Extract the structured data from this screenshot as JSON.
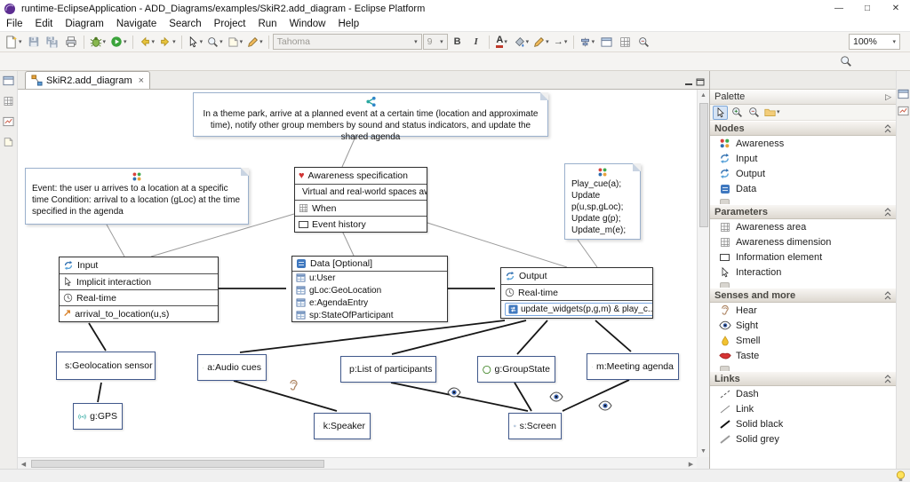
{
  "window": {
    "title": "runtime-EclipseApplication - ADD_Diagrams/examples/SkiR2.add_diagram - Eclipse Platform",
    "minimize": "—",
    "maximize": "□",
    "close": "✕"
  },
  "menubar": {
    "items": [
      "File",
      "Edit",
      "Diagram",
      "Navigate",
      "Search",
      "Project",
      "Run",
      "Window",
      "Help"
    ]
  },
  "toolbar": {
    "font": "Tahoma",
    "size": "9",
    "bold": "B",
    "italic": "I",
    "font_color": "A",
    "zoom": "100%"
  },
  "glyphs": {
    "caret": "▾",
    "diag_arrow": "↗",
    "right_arrow": "→",
    "pal_arrow": "▷",
    "up": "▲",
    "down": "▼",
    "left": "◀",
    "right": "▶",
    "heart": "♥"
  },
  "editor": {
    "tab": "SkiR2.add_diagram",
    "close": "×"
  },
  "palette": {
    "title": "Palette",
    "sections": [
      {
        "label": "Nodes",
        "items": [
          "Awareness",
          "Input",
          "Output",
          "Data"
        ]
      },
      {
        "label": "Parameters",
        "items": [
          "Awareness area",
          "Awareness dimension",
          "Information element",
          "Interaction"
        ]
      },
      {
        "label": "Senses and more",
        "items": [
          "Hear",
          "Sight",
          "Smell",
          "Taste"
        ]
      },
      {
        "label": "Links",
        "items": [
          "Dash",
          "Link",
          "Solid black",
          "Solid grey"
        ]
      }
    ]
  },
  "diagram": {
    "top_note": "In a theme park, arrive at a planned event at a certain time (location and approximate time), notify other group members by sound and status indicators, and update the shared agenda",
    "left_note": "Event: the user u arrives to a location at a specific time Condition: arrival to a location (gLoc) at the time specified in the agenda",
    "right_note_lines": [
      "Play_cue(a);",
      "Update",
      "p(u,sp,gLoc);",
      "Update g(p);",
      "Update_m(e);"
    ],
    "awareness": {
      "title": "Awareness specification",
      "rows": [
        "Virtual and real-world spaces aw...",
        "When",
        "Event history"
      ]
    },
    "input": {
      "title": "Input",
      "rows": [
        "Implicit interaction",
        "Real-time",
        "arrival_to_location(u,s)"
      ]
    },
    "data": {
      "title": "Data [Optional]",
      "rows": [
        "u:User",
        "gLoc:GeoLocation",
        "e:AgendaEntry",
        "sp:StateOfParticipant"
      ]
    },
    "output": {
      "title": "Output",
      "rows": [
        "Real-time",
        "update_widgets(p,g,m) & play_c..."
      ]
    },
    "nodes": {
      "geo": "s:Geolocation sensor",
      "gps": "g:GPS",
      "audio": "a:Audio cues",
      "speaker": "k:Speaker",
      "participants": "p:List of participants",
      "group": "g:GroupState",
      "screen": "s:Screen",
      "agenda": "m:Meeting agenda"
    }
  }
}
